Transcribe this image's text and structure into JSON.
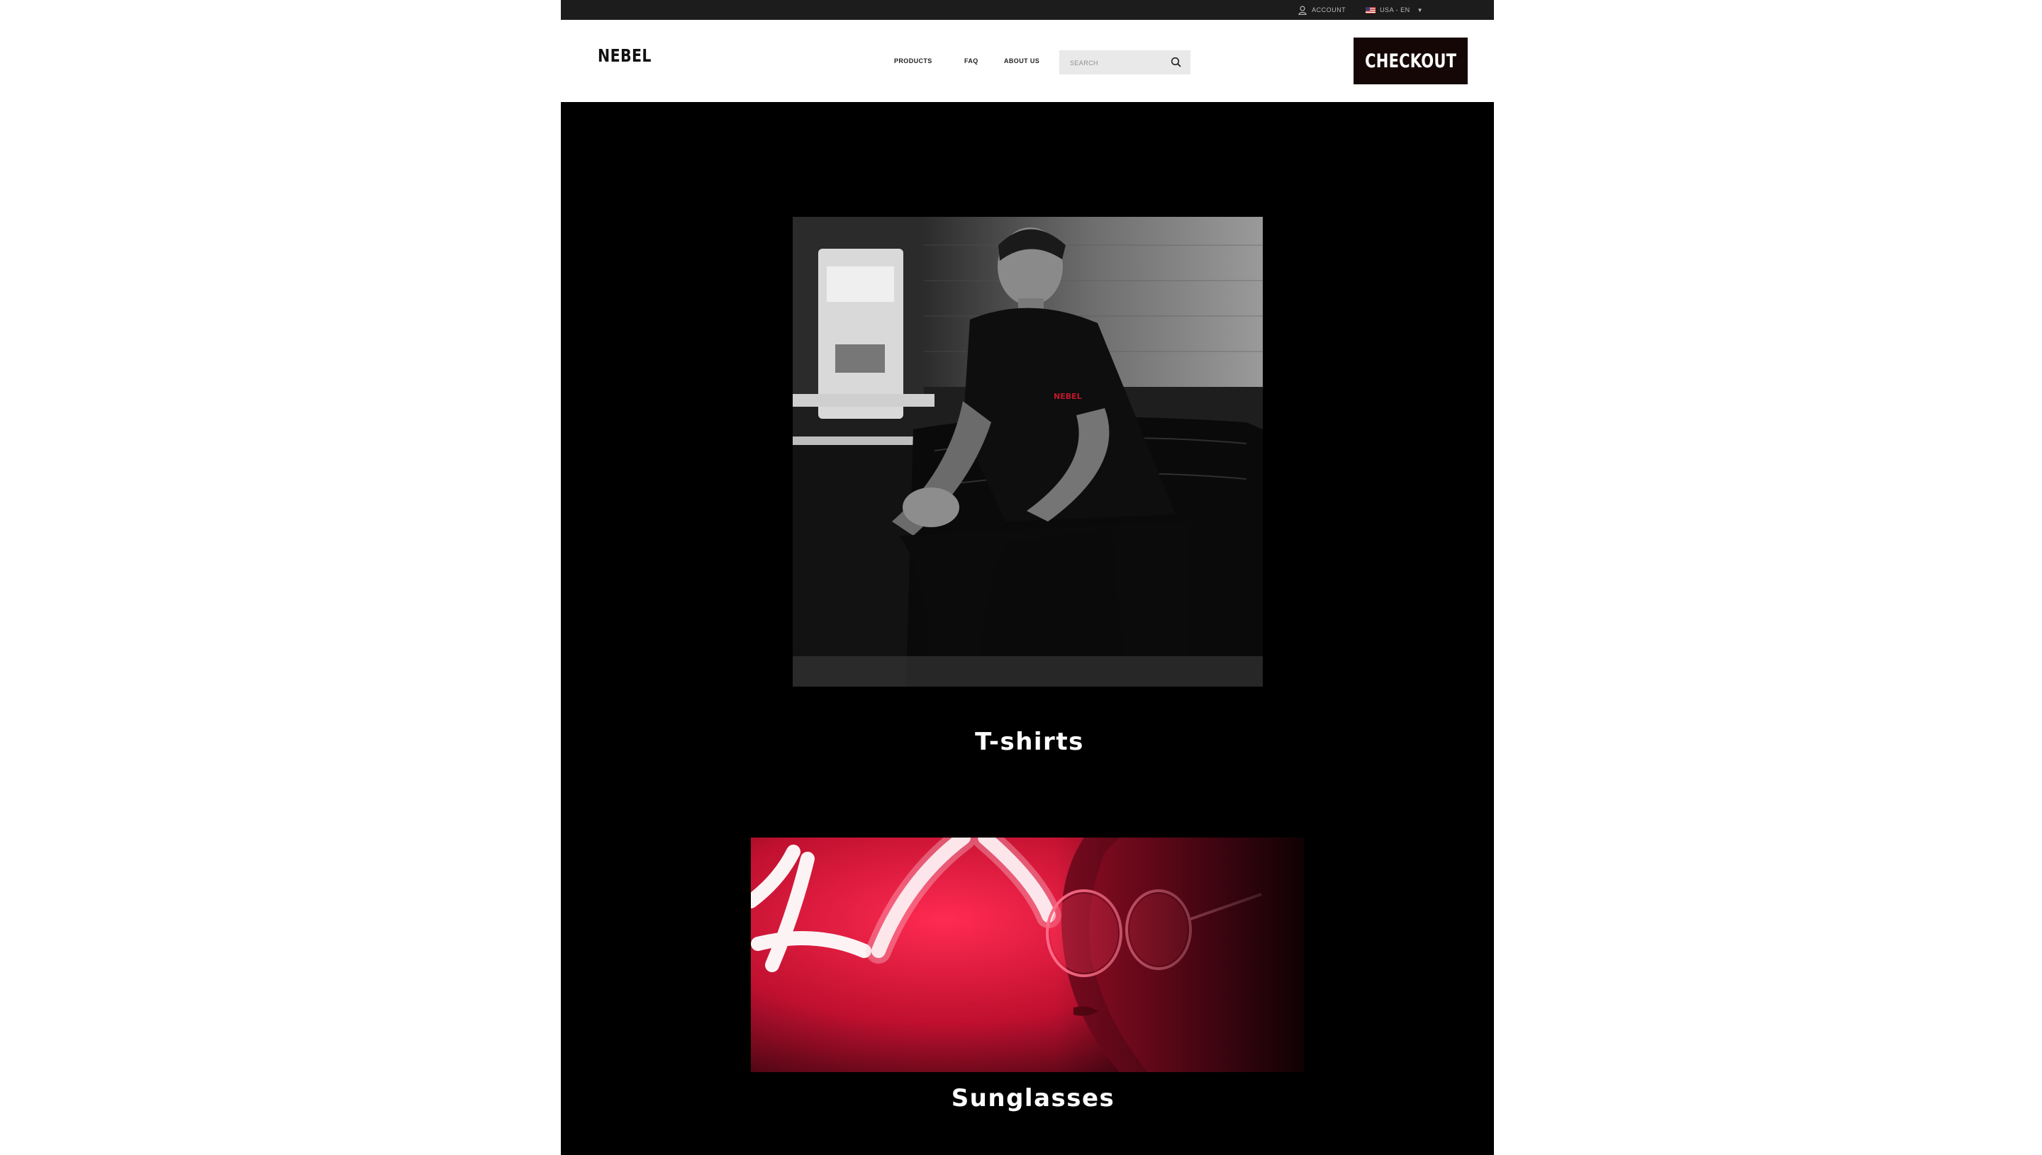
{
  "topbar": {
    "account_label": "ACCOUNT",
    "locale_label": "USA - EN",
    "locale_caret": "▼"
  },
  "header": {
    "logo": "NEBEL",
    "nav": [
      {
        "label": "PRODUCTS"
      },
      {
        "label": "FAQ"
      },
      {
        "label": "ABOUT US"
      }
    ],
    "search_placeholder": "SEARCH",
    "checkout_label": "CHECKOUT"
  },
  "collections": [
    {
      "title": "T-shirts",
      "image": "black-and-white photo of man in black NEBEL t-shirt sitting on leather sofa",
      "shirt_logo": "NEBEL"
    },
    {
      "title": "Sunglasses",
      "image": "red neon-lit close-up of woman wearing sunglasses"
    }
  ],
  "colors": {
    "page_background": "#000000",
    "topbar": "#1c1c1c",
    "checkout_button": "#160707",
    "accent_red": "#d01535"
  },
  "icons": {
    "account": "user-icon",
    "search": "search-icon",
    "flag": "us-flag-icon"
  }
}
